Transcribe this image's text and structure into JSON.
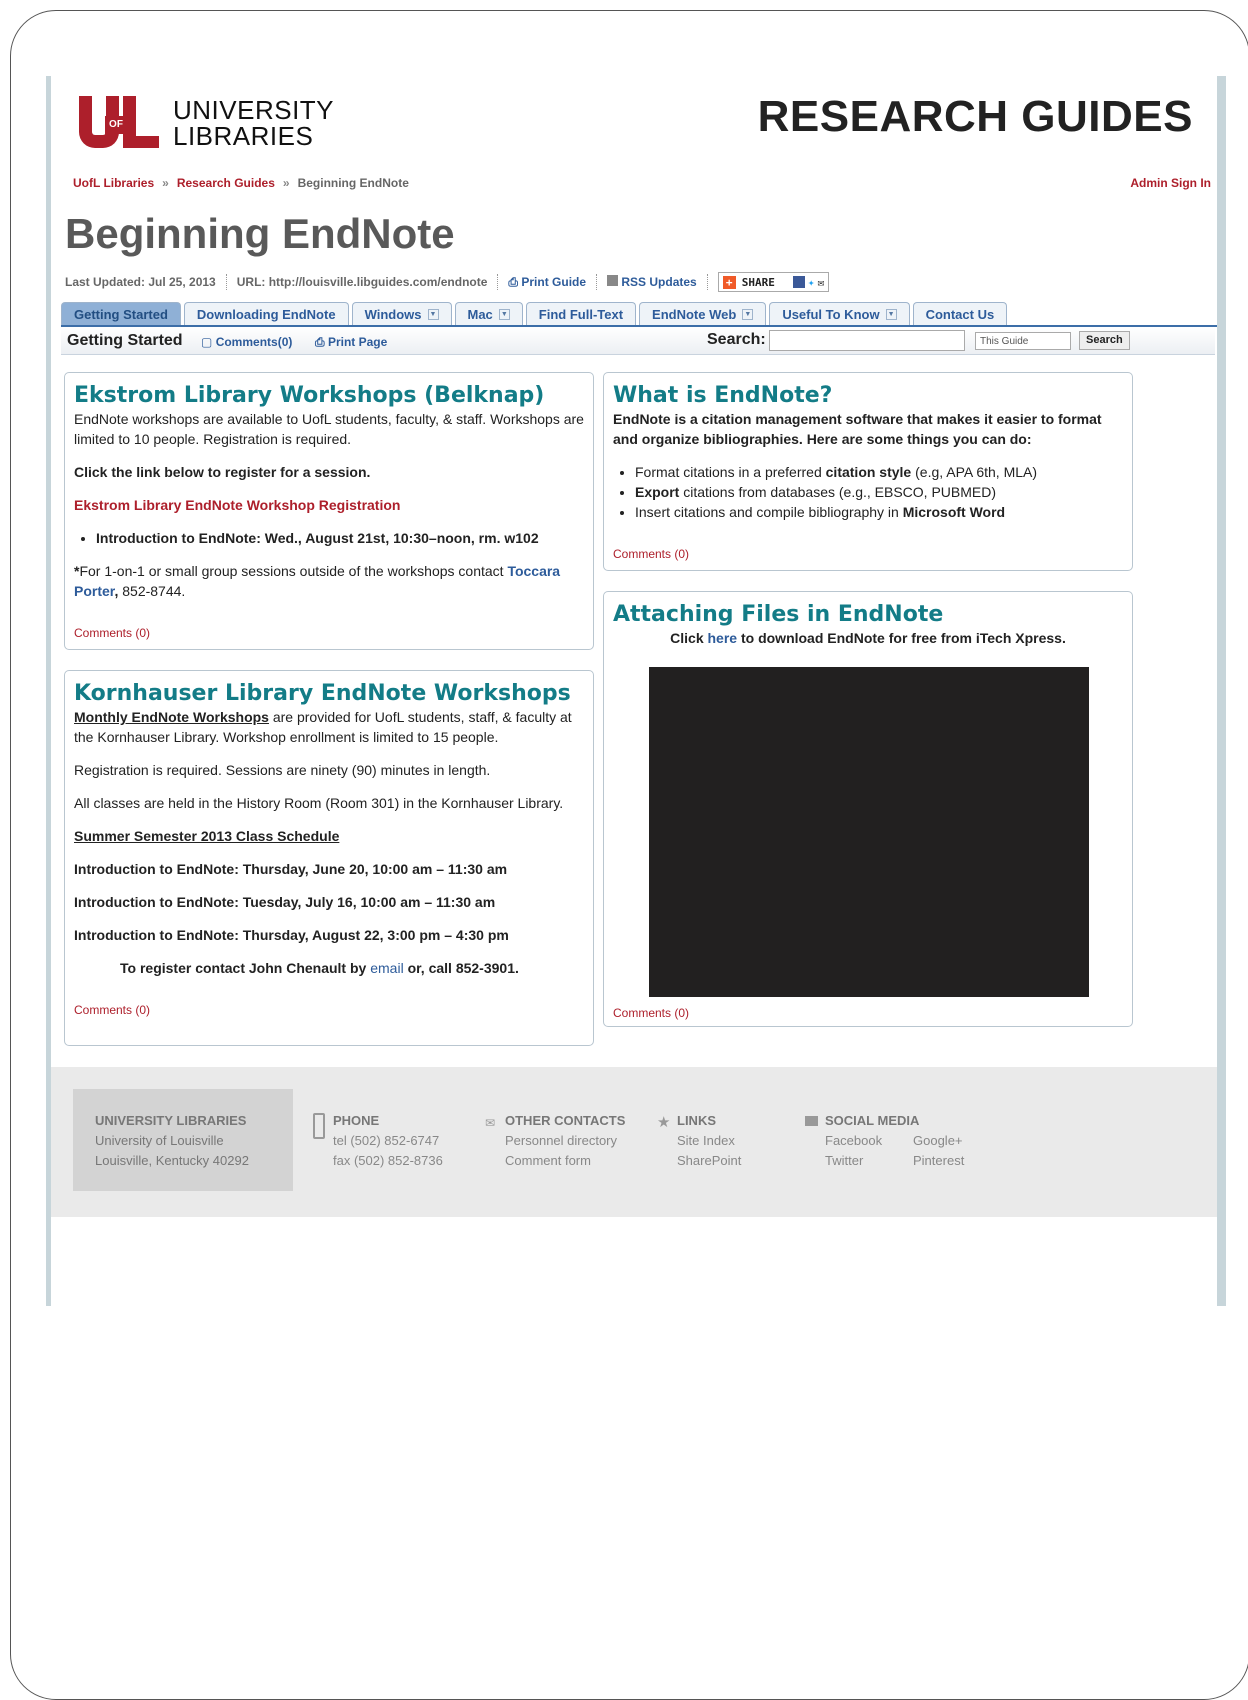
{
  "header": {
    "logo_text_line1": "UNIVERSITY",
    "logo_text_line2": "LIBRARIES",
    "logo_mark_text": "OF",
    "site_title": "RESEARCH GUIDES",
    "breadcrumb": [
      "UofL Libraries",
      "Research Guides",
      "Beginning EndNote"
    ],
    "breadcrumb_sep": "»",
    "admin_link": "Admin Sign In"
  },
  "guide": {
    "title": "Beginning EndNote",
    "last_updated": "Last Updated: Jul 25, 2013",
    "url": "URL: http://louisville.libguides.com/endnote",
    "print_guide": "Print Guide",
    "rss": "RSS Updates",
    "share": "SHARE"
  },
  "tabs": [
    {
      "label": "Getting Started",
      "dropdown": false,
      "active": true
    },
    {
      "label": "Downloading EndNote",
      "dropdown": false,
      "active": false
    },
    {
      "label": "Windows",
      "dropdown": true,
      "active": false
    },
    {
      "label": "Mac",
      "dropdown": true,
      "active": false
    },
    {
      "label": "Find Full-Text",
      "dropdown": false,
      "active": false
    },
    {
      "label": "EndNote Web",
      "dropdown": true,
      "active": false
    },
    {
      "label": "Useful To Know",
      "dropdown": true,
      "active": false
    },
    {
      "label": "Contact Us",
      "dropdown": false,
      "active": false
    }
  ],
  "subbar": {
    "page_title": "Getting Started",
    "comments": "Comments(0)",
    "print_page": "Print Page",
    "search_label": "Search:",
    "search_value": "",
    "scope": "This Guide",
    "search_button": "Search"
  },
  "boxes": {
    "ekstrom": {
      "title": "Ekstrom Library Workshops (Belknap)",
      "p1": "EndNote workshops are available to UofL students, faculty, & staff. Workshops are limited to 10 people. Registration is required.",
      "p2": "Click the link below to register for a session.",
      "reg_link": "Ekstrom Library EndNote Workshop Registration",
      "bullet": "Introduction to EndNote: Wed., August 21st, 10:30–noon, rm. w102",
      "p3_star": "*",
      "p3_text": "For 1-on-1 or small group sessions outside of the workshops contact ",
      "p3_link": "Toccara Porter",
      "p3_comma": ",",
      "p3_phone": " 852-8744.",
      "comments": "Comments (0)"
    },
    "kornhauser": {
      "title": "Kornhauser Library EndNote Workshops",
      "p1_link": "Monthly EndNote Workshops",
      "p1_text": " are provided for UofL students, staff, & faculty at the Kornhauser Library. Workshop enrollment is limited to 15 people.",
      "p2": "Registration is required. Sessions are ninety (90) minutes in length.",
      "p3": "All classes are held in the History Room (Room 301) in the Kornhauser Library.",
      "schedule_head": "Summer Semester 2013 Class Schedule",
      "s1": "Introduction to EndNote: Thursday, June 20, 10:00 am – 11:30 am",
      "s2": "Introduction to EndNote: Tuesday, July 16, 10:00 am – 11:30 am",
      "s3": "Introduction to EndNote: Thursday, August 22, 3:00 pm – 4:30 pm",
      "register_a": "To register contact John Chenault by ",
      "register_link": "email",
      "register_b": " or, call 852-3901.",
      "comments": "Comments (0)"
    },
    "what": {
      "title": "What is EndNote?",
      "p1": "EndNote is a citation management software that makes it easier to format and organize bibliographies. Here are some things you can do:",
      "b1a": "Format citations in a preferred ",
      "b1b": "citation style",
      "b1c": " (e.g, APA 6th, MLA)",
      "b2a": "Export",
      "b2b": " citations from databases (e.g., EBSCO, PUBMED)",
      "b3a": "Insert citations and compile bibliography in ",
      "b3b": "Microsoft Word",
      "comments": "Comments (0)"
    },
    "attaching": {
      "title": "Attaching Files in EndNote",
      "p_a": "Click ",
      "p_link": "here",
      "p_b": " to download EndNote for free from iTech Xpress.",
      "comments": "Comments (0)"
    }
  },
  "footer": {
    "addr_head": "UNIVERSITY LIBRARIES",
    "addr1": "University of Louisville",
    "addr2": "Louisville, Kentucky 40292",
    "phone_head": "PHONE",
    "tel": "tel (502) 852-6747",
    "fax": "fax (502) 852-8736",
    "contacts_head": "OTHER CONTACTS",
    "personnel": "Personnel directory",
    "comment_form": "Comment form",
    "links_head": "LINKS",
    "site_index": "Site Index",
    "sharepoint": "SharePoint",
    "social_head": "SOCIAL MEDIA",
    "facebook": "Facebook",
    "googleplus": "Google+",
    "twitter": "Twitter",
    "pinterest": "Pinterest"
  }
}
